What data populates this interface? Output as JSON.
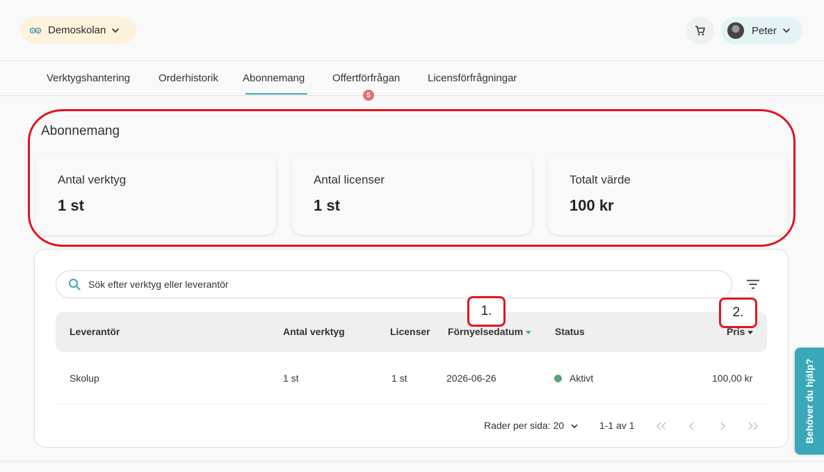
{
  "header": {
    "school_name": "Demoskolan",
    "user_name": "Peter",
    "icons": [
      "glasses-icon",
      "chevron-down-icon",
      "cart-icon",
      "avatar"
    ]
  },
  "tabs": [
    {
      "label": "Verktygshantering"
    },
    {
      "label": "Orderhistorik"
    },
    {
      "label": "Abonnemang",
      "active": true
    },
    {
      "label": "Offertförfrågan",
      "badge": "5"
    },
    {
      "label": "Licensförfrågningar"
    }
  ],
  "summary": {
    "title": "Abonnemang",
    "cards": [
      {
        "label": "Antal verktyg",
        "value": "1 st"
      },
      {
        "label": "Antal licenser",
        "value": "1 st"
      },
      {
        "label": "Totalt värde",
        "value": "100 kr"
      }
    ]
  },
  "search": {
    "placeholder": "Sök efter verktyg eller leverantör"
  },
  "table": {
    "columns": [
      "Leverantör",
      "Antal verktyg",
      "Licenser",
      "Förnyelsedatum",
      "Status",
      "Pris"
    ],
    "rows": [
      {
        "supplier": "Skolup",
        "tools": "1 st",
        "licenses": "1 st",
        "renewal": "2026-06-26",
        "status": "Aktivt",
        "price": "100,00 kr"
      }
    ]
  },
  "pagination": {
    "rows_per_page_label": "Rader per sida: 20",
    "range": "1-1 av 1"
  },
  "callouts": [
    "1.",
    "2."
  ],
  "help": {
    "label": "Behöver du hjälp?"
  },
  "colors": {
    "accent": "#3aa8b8",
    "status_active": "#5ba478",
    "badge": "#e2707a",
    "annotation": "#e1141f"
  }
}
